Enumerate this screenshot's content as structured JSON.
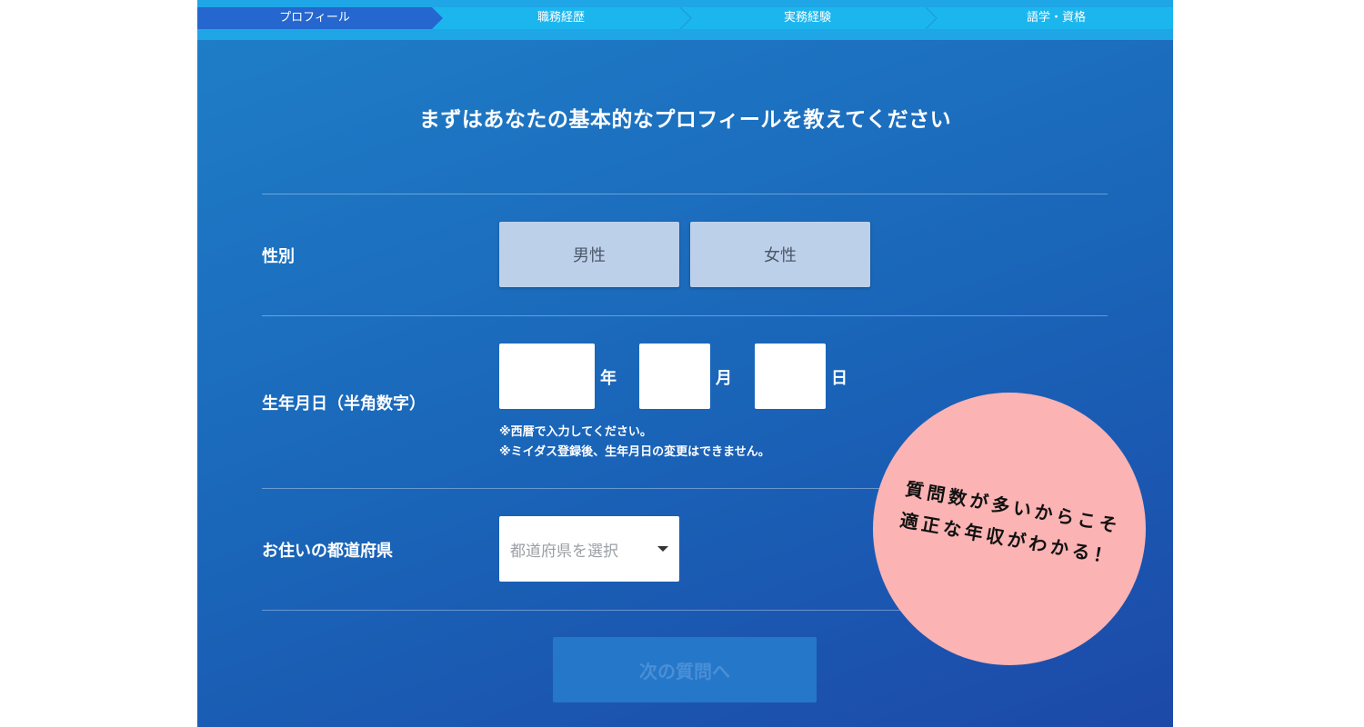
{
  "stepper": {
    "steps": [
      {
        "label": "プロフィール",
        "active": true
      },
      {
        "label": "職務経歴",
        "active": false
      },
      {
        "label": "実務経験",
        "active": false
      },
      {
        "label": "語学・資格",
        "active": false
      }
    ],
    "active_color": "#2566cf",
    "bar_color": "#1cb6ee"
  },
  "heading": "まずはあなたの基本的なプロフィールを教えてください",
  "gender": {
    "label": "性別",
    "options": [
      "男性",
      "女性"
    ]
  },
  "birthdate": {
    "label": "生年月日（半角数字）",
    "year_value": "",
    "year_unit": "年",
    "month_value": "",
    "month_unit": "月",
    "day_value": "",
    "day_unit": "日",
    "notes": [
      "※西暦で入力してください。",
      "※ミイダス登録後、生年月日の変更はできません。"
    ]
  },
  "prefecture": {
    "label": "お住いの都道府県",
    "placeholder": "都道府県を選択"
  },
  "next_button": "次の質問へ",
  "badge": {
    "lines": [
      "質問数が多いからこそ",
      "適正な年収がわかる！"
    ],
    "color": "#fbb3b3"
  }
}
